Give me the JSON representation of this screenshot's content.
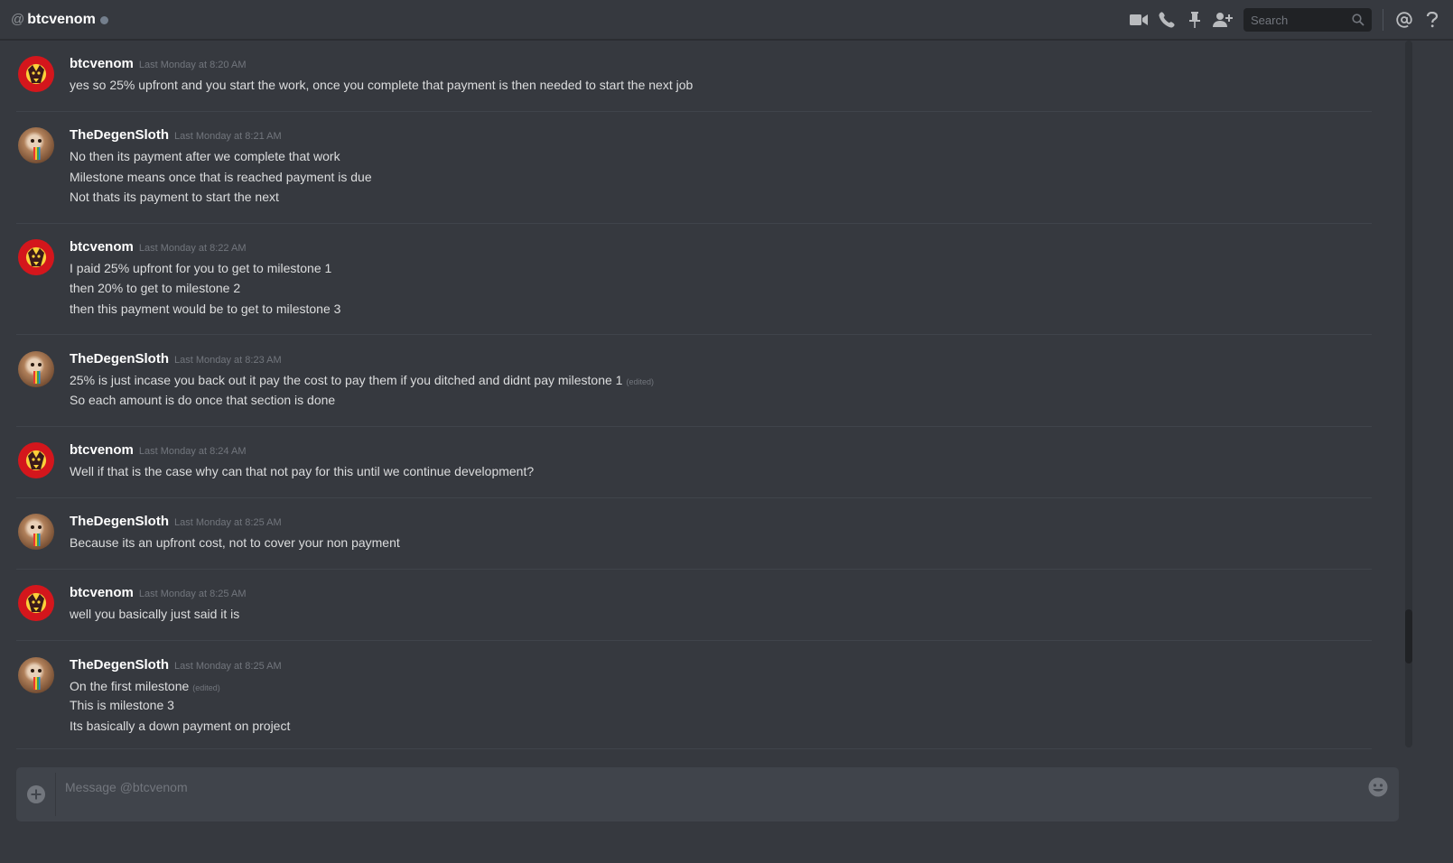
{
  "header": {
    "at_symbol": "@",
    "channel_name": "btcvenom",
    "search_placeholder": "Search",
    "icons": [
      "video-camera-icon",
      "phone-call-icon",
      "pin-icon",
      "add-friend-icon",
      "search-icon",
      "mention-icon",
      "help-icon"
    ]
  },
  "messages": [
    {
      "author": "btcvenom",
      "avatar": "venom-avatar",
      "timestamp": "Last Monday at 8:20 AM",
      "lines": [
        {
          "text": "yes so 25% upfront and you start the work, once you complete that payment is then needed to start the next job",
          "edited": ""
        }
      ]
    },
    {
      "author": "TheDegenSloth",
      "avatar": "sloth-avatar",
      "timestamp": "Last Monday at 8:21 AM",
      "lines": [
        {
          "text": "No then its payment after we complete that work",
          "edited": ""
        },
        {
          "text": "Milestone means once that is reached payment is due",
          "edited": ""
        },
        {
          "text": "Not thats its payment to start the next",
          "edited": ""
        }
      ]
    },
    {
      "author": "btcvenom",
      "avatar": "venom-avatar",
      "timestamp": "Last Monday at 8:22 AM",
      "lines": [
        {
          "text": "I paid 25% upfront for you to get to milestone 1",
          "edited": ""
        },
        {
          "text": "then 20% to get to milestone 2",
          "edited": ""
        },
        {
          "text": "then this payment would be to get to milestone 3",
          "edited": ""
        }
      ]
    },
    {
      "author": "TheDegenSloth",
      "avatar": "sloth-avatar",
      "timestamp": "Last Monday at 8:23 AM",
      "lines": [
        {
          "text": "25% is just incase you back out it pay the cost to pay them if you ditched and didnt pay milestone 1",
          "edited": "(edited)"
        },
        {
          "text": "So each amount is do once that section is done",
          "edited": ""
        }
      ]
    },
    {
      "author": "btcvenom",
      "avatar": "venom-avatar",
      "timestamp": "Last Monday at 8:24 AM",
      "lines": [
        {
          "text": "Well if that is the case why can that not pay for this until we continue development?",
          "edited": ""
        }
      ]
    },
    {
      "author": "TheDegenSloth",
      "avatar": "sloth-avatar",
      "timestamp": "Last Monday at 8:25 AM",
      "lines": [
        {
          "text": "Because its an upfront cost, not to cover your non payment",
          "edited": ""
        }
      ]
    },
    {
      "author": "btcvenom",
      "avatar": "venom-avatar",
      "timestamp": "Last Monday at 8:25 AM",
      "lines": [
        {
          "text": "well you basically just said it is",
          "edited": ""
        }
      ]
    },
    {
      "author": "TheDegenSloth",
      "avatar": "sloth-avatar",
      "timestamp": "Last Monday at 8:25 AM",
      "lines": [
        {
          "text": "On the first milestone",
          "edited": "(edited)"
        },
        {
          "text": "This is milestone 3",
          "edited": ""
        },
        {
          "text": "Its basically a down payment on project",
          "edited": ""
        }
      ]
    }
  ],
  "composer": {
    "placeholder": "Message @btcvenom",
    "value": ""
  },
  "colors": {
    "background": "#36393f",
    "composer": "#40444b",
    "author": "#ffffff",
    "text": "#dcddde",
    "muted": "#72767d",
    "status_offline": "#747f8d"
  }
}
